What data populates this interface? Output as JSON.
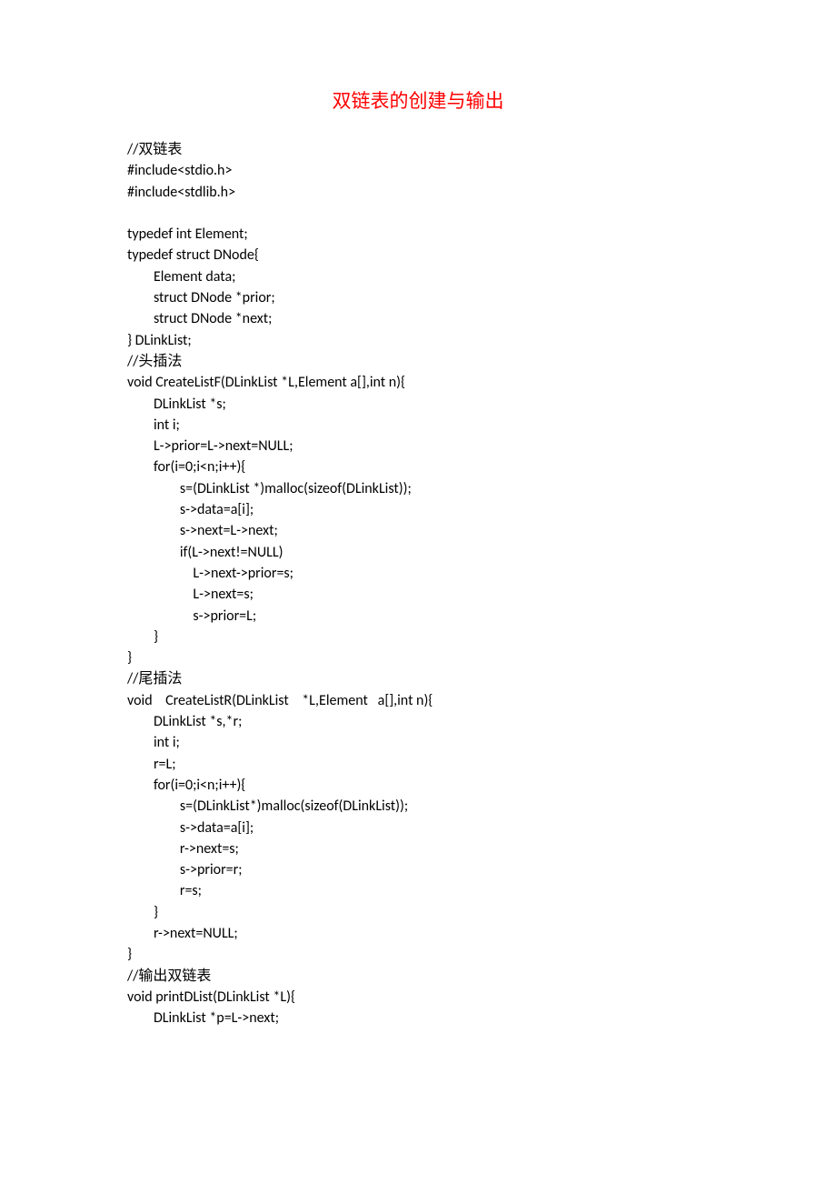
{
  "title": "双链表的创建与输出",
  "code": "//双链表\n#include<stdio.h>\n#include<stdlib.h>\n\ntypedef int Element;\ntypedef struct DNode{\n        Element data;\n        struct DNode *prior;\n        struct DNode *next;\n} DLinkList;\n//头插法\nvoid CreateListF(DLinkList *L,Element a[],int n){\n        DLinkList *s;\n        int i;\n        L->prior=L->next=NULL;\n        for(i=0;i<n;i++){\n                s=(DLinkList *)malloc(sizeof(DLinkList));\n                s->data=a[i];\n                s->next=L->next;\n                if(L->next!=NULL)\n                    L->next->prior=s;\n                    L->next=s;\n                    s->prior=L;\n        }\n}\n//尾插法\nvoid    CreateListR(DLinkList    *L,Element   a[],int n){\n        DLinkList *s,*r;\n        int i;\n        r=L;\n        for(i=0;i<n;i++){\n                s=(DLinkList*)malloc(sizeof(DLinkList));\n                s->data=a[i];\n                r->next=s;\n                s->prior=r;\n                r=s;\n        }\n        r->next=NULL;\n}\n//输出双链表\nvoid printDList(DLinkList *L){\n        DLinkList *p=L->next;"
}
